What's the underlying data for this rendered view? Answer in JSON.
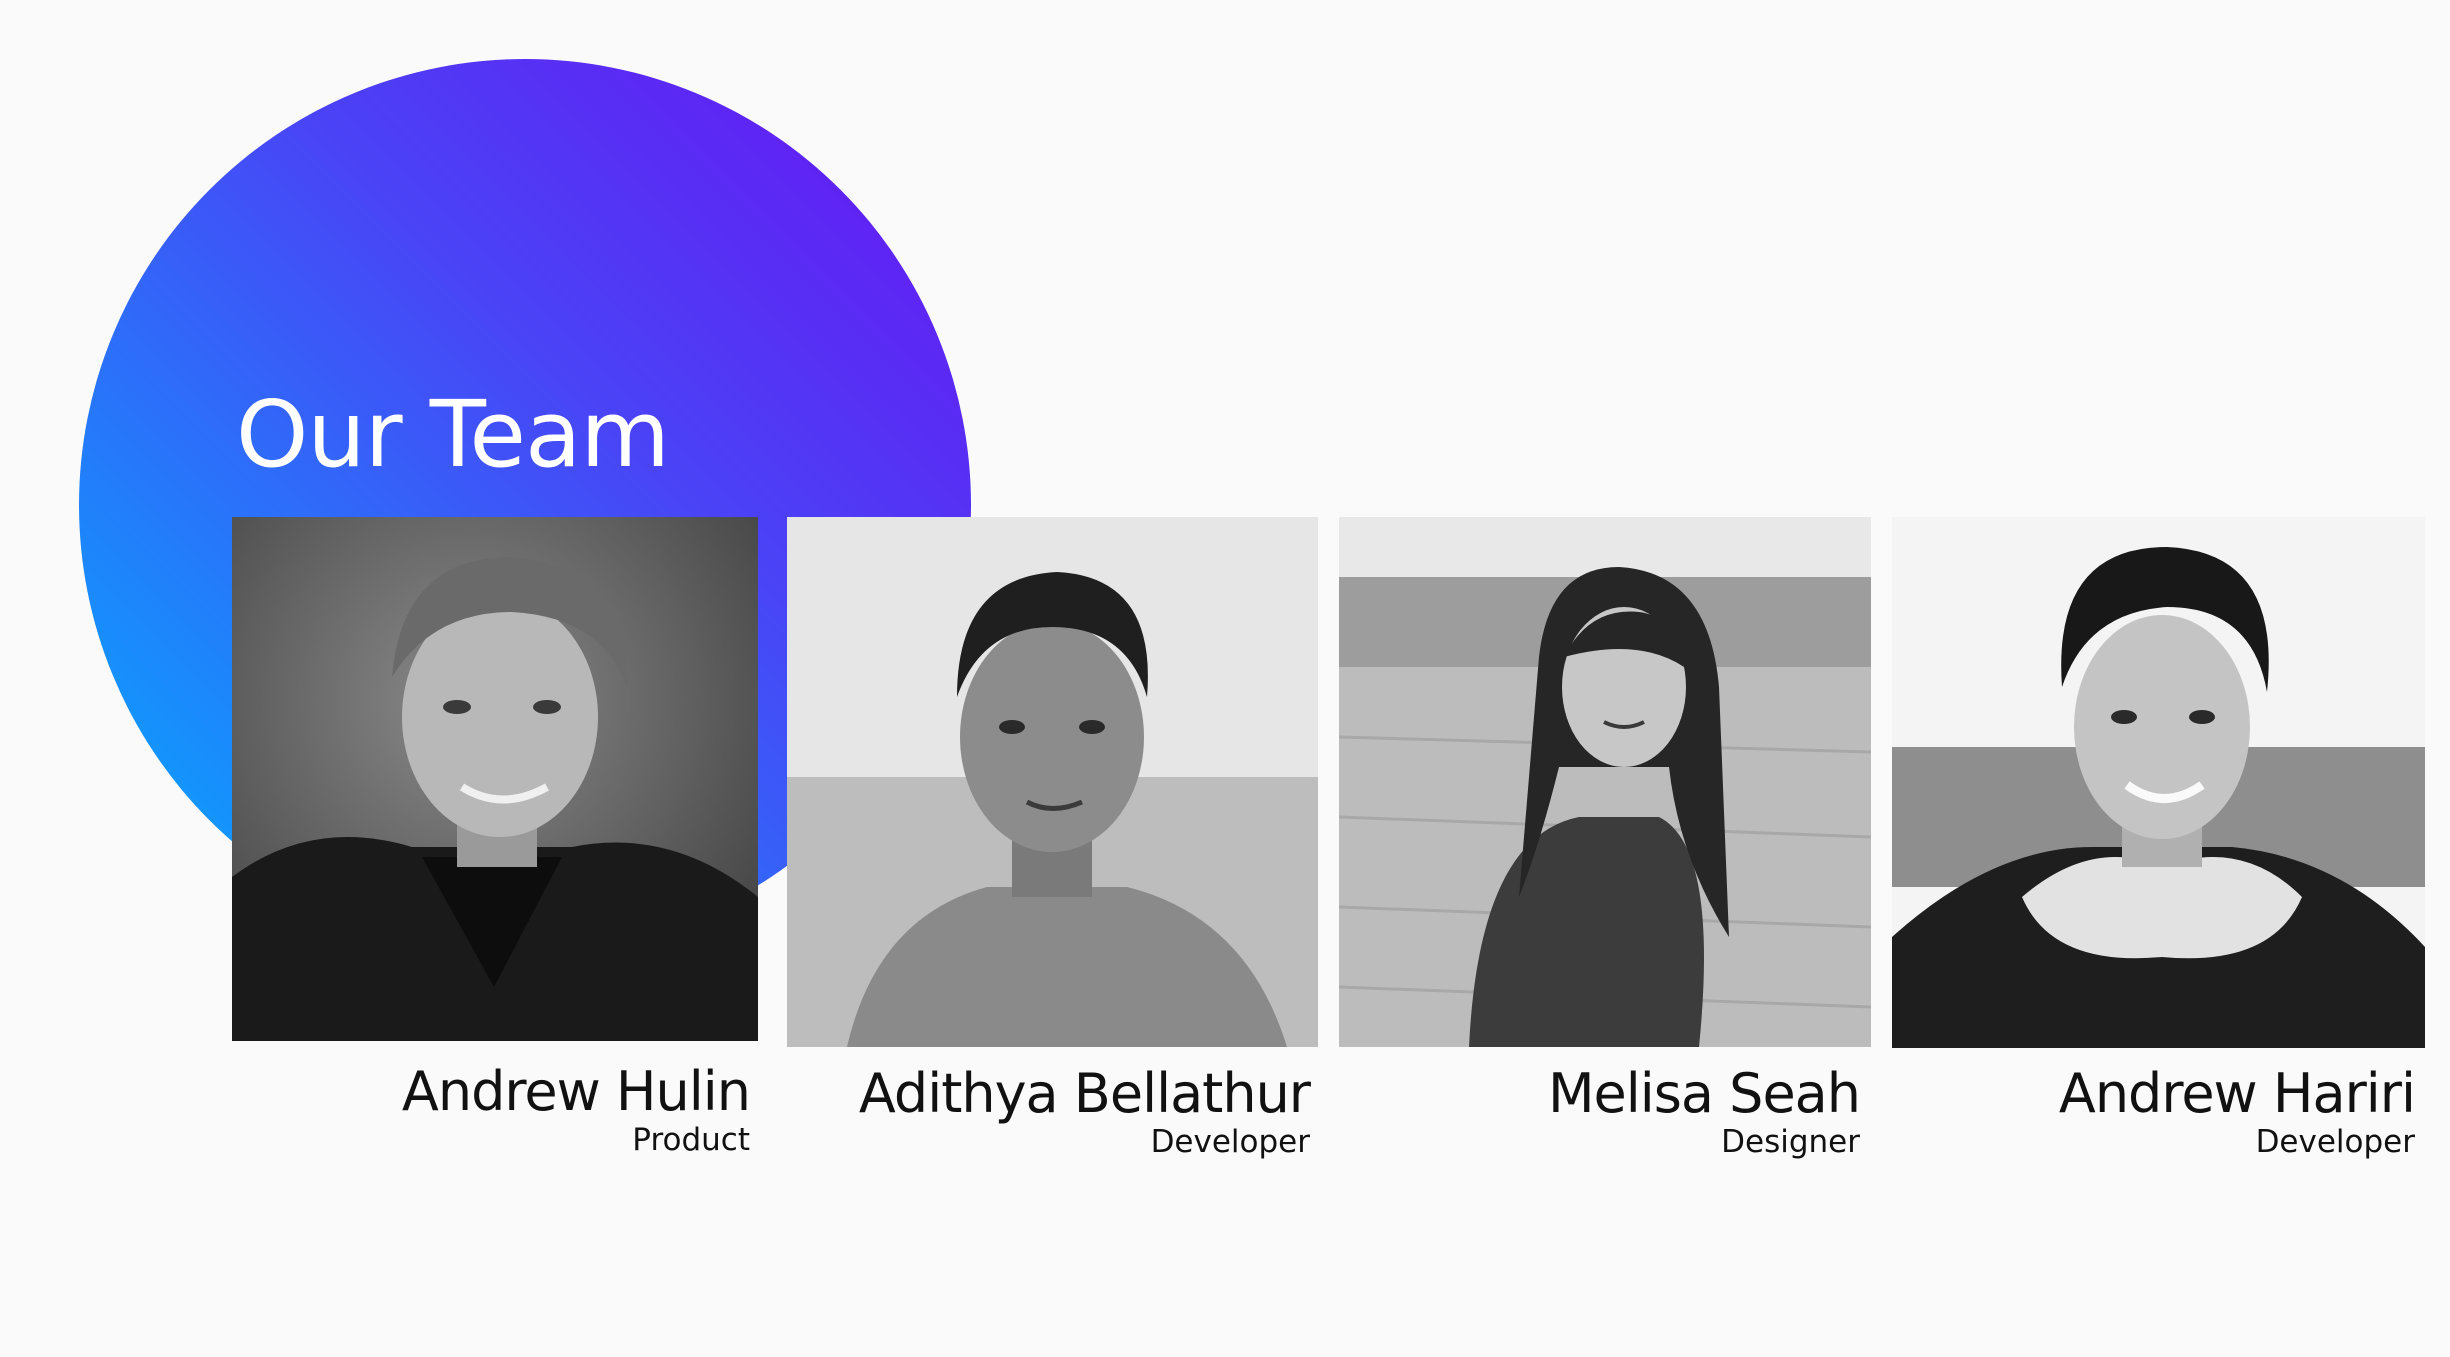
{
  "title": "Our Team",
  "accent_gradient": [
    "#6a12f2",
    "#04aefe"
  ],
  "team": [
    {
      "name": "Andrew Hulin",
      "role": "Product"
    },
    {
      "name": "Adithya Bellathur",
      "role": "Developer"
    },
    {
      "name": "Melisa Seah",
      "role": "Designer"
    },
    {
      "name": "Andrew Hariri",
      "role": "Developer"
    }
  ]
}
